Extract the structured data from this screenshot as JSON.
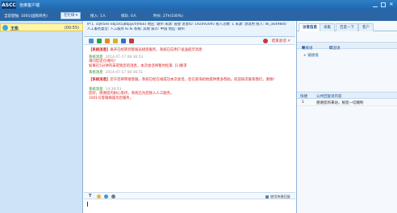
{
  "window": {
    "logo": "ASCC",
    "title": "坐席客户端",
    "close_glyph": "✕"
  },
  "statusbar": {
    "login": "当前登陆: 1001(国际商务)",
    "status_select": "在忙碌 ▾",
    "queue": "接入: 1人",
    "waiting": "排队: 0人",
    "time": "时长: 27h(100%)"
  },
  "sessions": [
    {
      "name": "王凯",
      "timer": "(00:55)"
    }
  ],
  "visitor": {
    "line1": "IP:1. cq9i5es-xbj5ik5j8bpjs/0(REE)  地区: 赣州  来源: 直接  访客ID: 192092095  接入次数: 1 来源: 测试用  接入: 4k_ak49840",
    "line2": "人工服务类型: 人工服务  IE:IE  系统: 其他  城市: 中国 地区: 赣州"
  },
  "chat_toolbar": {
    "end_label": "结束会话 ✕"
  },
  "messages": [
    {
      "kind": "notice",
      "label": "【系统消息】",
      "text": "离开已经转到客服员接受服务，系统已向用户发送提示消息"
    },
    {
      "kind": "system",
      "sender": "系统消息",
      "ts": "2014-07-17 08:36:53",
      "lines": [
        "请问您还在线吗?",
        "如果在5分钟内未得到您的消息，本次会话将暂时结束. [1]要求"
      ]
    },
    {
      "kind": "system",
      "sender": "系统消息",
      "ts": "2014-07-17 08:36:51",
      "lines": []
    },
    {
      "kind": "notice",
      "label": "【系统消息】",
      "text": "您于您将转接客服，系统已经在线成功本次会话，您在查询初始提供更多帮助，欢迎再次联系我们，谢谢!"
    },
    {
      "kind": "system",
      "sender": "系统消息",
      "ts": "14:39:53",
      "lines": [
        "您好，感谢您的耐心等待，系统已为您接入人工服务。",
        "1001号客服竭诚为您服务。"
      ]
    }
  ],
  "input": {
    "font_label": "T",
    "quick_reply_label": "使用快捷回复"
  },
  "right_panel": {
    "tabs": [
      "访客信息",
      "采集",
      "百度一下",
      "客户"
    ],
    "radios": [
      "链接语",
      "欢迎语"
    ],
    "tree_item": "+ 链接语",
    "table_headers": [
      "快捷",
      "公共回复语内容"
    ],
    "table_rows": [
      {
        "key": "1",
        "value": "感谢您的来访，祝您一切顺利"
      }
    ]
  },
  "colors": {
    "titlebar": "#2f7fc6",
    "statusbar": "#2a66a5",
    "left_panel": "#cfe3f6",
    "active_session": "#fff6a8",
    "notice_red": "#d42121",
    "system_green": "#2c8a2c"
  }
}
